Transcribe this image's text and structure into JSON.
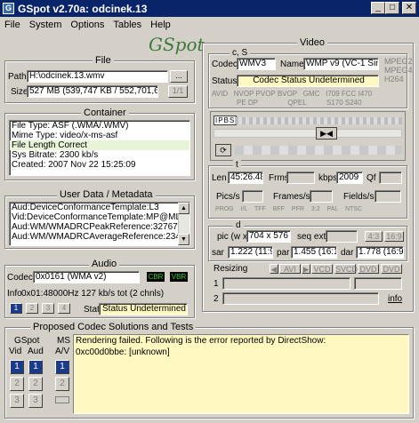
{
  "window": {
    "title": "GSpot v2.70a: odcinek.13",
    "minimize": "_",
    "maximize": "□",
    "close": "✕"
  },
  "menu": [
    "File",
    "System",
    "Options",
    "Tables",
    "Help"
  ],
  "logo": "GSpot",
  "file": {
    "title": "File",
    "path_label": "Path",
    "path": "H:\\odcinek.13.wmv",
    "browse": "...",
    "size_label": "Size",
    "size": "527 MB (539,747 KB / 552,701,608",
    "part": "1/1"
  },
  "container": {
    "title": "Container",
    "lines": [
      "File Type: ASF (.WMA/.WMV)",
      "Mime Type: video/x-ms-asf",
      "File Length Correct",
      "Sys Bitrate: 2300 kb/s",
      "Created:    2007 Nov 22   15:25:09"
    ]
  },
  "userdata": {
    "title": "User Data / Metadata",
    "lines": [
      "Aud:DeviceConformanceTemplate:L3",
      "Vid:DeviceConformanceTemplate:MP@ML",
      "Aud:WM/WMADRCPeakReference:32767",
      "Aud:WM/WMADRCAverageReference:2340"
    ]
  },
  "audio": {
    "title": "Audio",
    "codec_label": "Codec",
    "codec": "0x0161 (WMA v2)",
    "cbr": "CBR",
    "vbr": "VBR",
    "info_label": "Info",
    "info": "0x01:48000Hz  127 kb/s tot (2 chnls)",
    "stream_buttons": [
      "1",
      "2",
      "3",
      "4"
    ],
    "stat_label": "Stat",
    "stat": "Status Undetermined"
  },
  "video": {
    "title": "Video",
    "cs_label": "c, S",
    "codec_label": "Codec",
    "codec": "WMV3",
    "name_label": "Name",
    "name": "WMP v9 (VC-1 Simpl",
    "codec_tags": [
      "MPEG2",
      "MPEG4",
      "H264"
    ],
    "status_label": "Status",
    "status": "Codec Status Undetermined",
    "flags_row1": [
      "AVID",
      "NVOP",
      "PVOP",
      "BVOP",
      "GMC",
      "I709",
      "FCC",
      "I470"
    ],
    "flags_row2": [
      "PE",
      "DP",
      "QPEL",
      "S170",
      "S240"
    ],
    "ipbs": [
      "I",
      "P",
      "B",
      "S"
    ],
    "t_label": "t",
    "len_label": "Len",
    "len": "45:26.48",
    "frms_label": "Frms",
    "kbps_label": "kbps",
    "kbps": "2009",
    "qf_label": "Qf",
    "pics_label": "Pics/s",
    "frames_label": "Frames/s",
    "fields_label": "Fields/s",
    "flags_row3": [
      "PROG",
      "I/L",
      "TFF",
      "BFF",
      "PFR",
      "3:2",
      "PAL",
      "NTSC"
    ],
    "d_label": "d",
    "pic_label": "pic (w x h)",
    "pic": "704 x 576",
    "seq_label": "seq ext",
    "aspect_btns": [
      "4:3",
      "16:9"
    ],
    "sar_label": "sar",
    "sar": "1.222 (11:9)",
    "par_label": "par",
    "par": "1.455 (16:1",
    "dar_label": "dar",
    "dar": "1.778 (16:9)",
    "resizing_label": "Resizing",
    "resize_btns": [
      "AVI",
      "VCD",
      "SVCD",
      "DVD",
      "DVD"
    ],
    "row1_label": "1",
    "row2_label": "2",
    "info_link": "info"
  },
  "codecs": {
    "title": "Proposed Codec Solutions and Tests",
    "gspot_label": "GSpot",
    "vid_label": "Vid",
    "aud_label": "Aud",
    "ms_label": "MS",
    "av_label": "A/V",
    "nums": [
      "1",
      "2",
      "3"
    ],
    "message": [
      "Rendering failed. Following is the error reported by DirectShow:",
      "0xc00d0bbe: [unknown]"
    ]
  }
}
